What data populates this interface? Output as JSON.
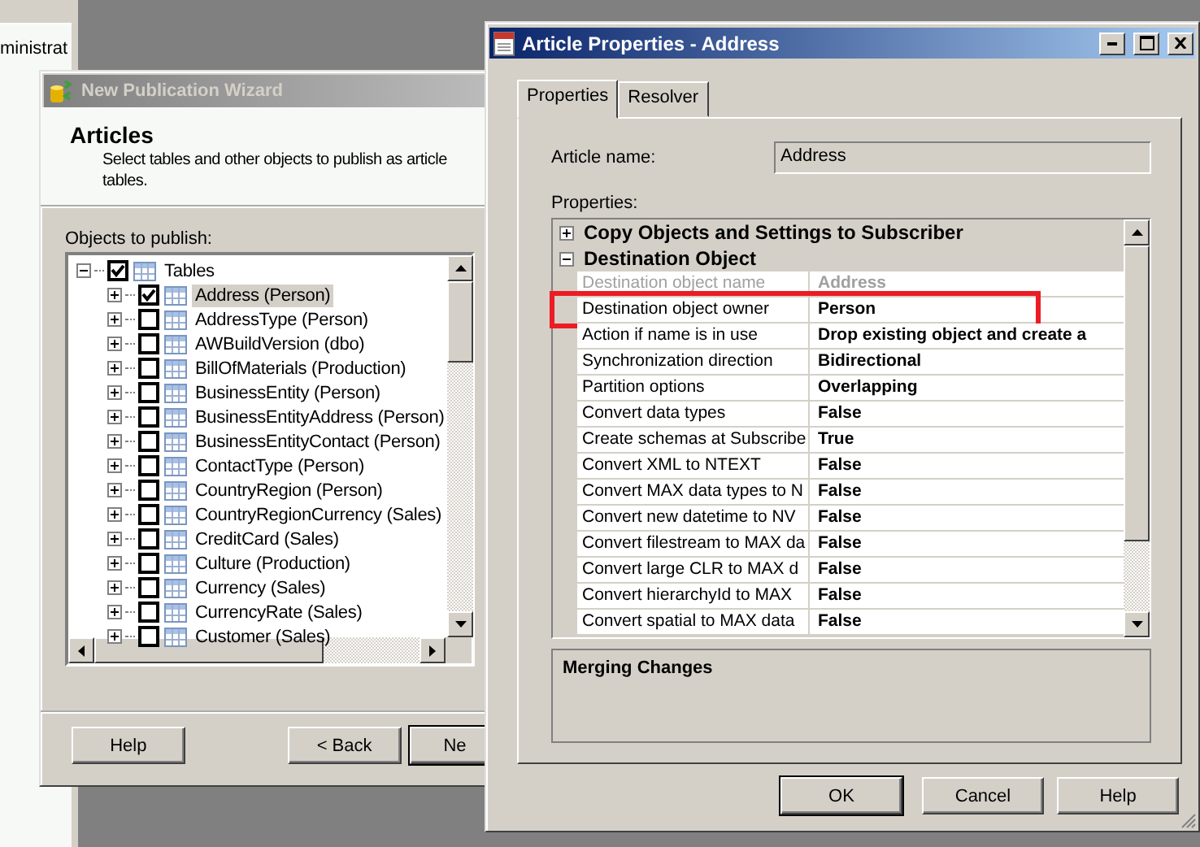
{
  "background_window": {
    "text": "ministrat"
  },
  "wizard": {
    "title": "New Publication Wizard",
    "heading": "Articles",
    "description_lines": [
      "Select tables and other objects to publish as article",
      "tables."
    ],
    "tree_label": "Objects to publish:",
    "tree": [
      {
        "label": "Tables",
        "checked": true,
        "expanded": true,
        "selected": false,
        "children": [
          {
            "label": "Address (Person)",
            "checked": true,
            "expanded": false,
            "selected": true
          },
          {
            "label": "AddressType (Person)",
            "checked": false,
            "expanded": false,
            "selected": false
          },
          {
            "label": "AWBuildVersion (dbo)",
            "checked": false,
            "expanded": false,
            "selected": false
          },
          {
            "label": "BillOfMaterials (Production)",
            "checked": false,
            "expanded": false,
            "selected": false
          },
          {
            "label": "BusinessEntity (Person)",
            "checked": false,
            "expanded": false,
            "selected": false
          },
          {
            "label": "BusinessEntityAddress (Person)",
            "checked": false,
            "expanded": false,
            "selected": false
          },
          {
            "label": "BusinessEntityContact (Person)",
            "checked": false,
            "expanded": false,
            "selected": false
          },
          {
            "label": "ContactType (Person)",
            "checked": false,
            "expanded": false,
            "selected": false
          },
          {
            "label": "CountryRegion (Person)",
            "checked": false,
            "expanded": false,
            "selected": false
          },
          {
            "label": "CountryRegionCurrency (Sales)",
            "checked": false,
            "expanded": false,
            "selected": false
          },
          {
            "label": "CreditCard (Sales)",
            "checked": false,
            "expanded": false,
            "selected": false
          },
          {
            "label": "Culture (Production)",
            "checked": false,
            "expanded": false,
            "selected": false
          },
          {
            "label": "Currency (Sales)",
            "checked": false,
            "expanded": false,
            "selected": false
          },
          {
            "label": "CurrencyRate (Sales)",
            "checked": false,
            "expanded": false,
            "selected": false
          },
          {
            "label": "Customer (Sales)",
            "checked": false,
            "expanded": false,
            "selected": false
          }
        ]
      }
    ],
    "buttons": [
      {
        "label": "Help",
        "default": false
      },
      {
        "label": "< Back",
        "default": false
      },
      {
        "label": "Ne",
        "default": true
      }
    ]
  },
  "properties_window": {
    "title": "Article Properties - Address",
    "tabs": [
      {
        "label": "Properties",
        "selected": true
      },
      {
        "label": "Resolver",
        "selected": false
      }
    ],
    "article_name_label": "Article name:",
    "article_name": "Address",
    "properties_label": "Properties:",
    "categories": [
      {
        "label": "Copy Objects and Settings to Subscriber",
        "expanded": false
      },
      {
        "label": "Destination Object",
        "expanded": true,
        "properties": [
          {
            "name": "Destination object name",
            "value": "Address",
            "disabled": true,
            "highlighted": false
          },
          {
            "name": "Destination object owner",
            "value": "Person",
            "disabled": false,
            "highlighted": true
          },
          {
            "name": "Action if name is in use",
            "value": "Drop existing object and create a",
            "disabled": false,
            "highlighted": false
          },
          {
            "name": "Synchronization direction",
            "value": "Bidirectional",
            "disabled": false,
            "highlighted": false
          },
          {
            "name": "Partition options",
            "value": "Overlapping",
            "disabled": false,
            "highlighted": false
          },
          {
            "name": "Convert data types",
            "value": "False",
            "disabled": false,
            "highlighted": false
          },
          {
            "name": "Create schemas at Subscribe",
            "value": "True",
            "disabled": false,
            "highlighted": false
          },
          {
            "name": "Convert XML to NTEXT",
            "value": "False",
            "disabled": false,
            "highlighted": false
          },
          {
            "name": "Convert MAX data types to N",
            "value": "False",
            "disabled": false,
            "highlighted": false
          },
          {
            "name": "Convert new datetime to NV",
            "value": "False",
            "disabled": false,
            "highlighted": false
          },
          {
            "name": "Convert filestream to MAX da",
            "value": "False",
            "disabled": false,
            "highlighted": false
          },
          {
            "name": "Convert large CLR to MAX d",
            "value": "False",
            "disabled": false,
            "highlighted": false
          },
          {
            "name": "Convert hierarchyId to MAX",
            "value": "False",
            "disabled": false,
            "highlighted": false
          },
          {
            "name": "Convert spatial to MAX data",
            "value": "False",
            "disabled": false,
            "highlighted": false
          }
        ]
      }
    ],
    "description_title": "Merging Changes",
    "buttons": [
      {
        "label": "OK",
        "default": true
      },
      {
        "label": "Cancel",
        "default": false
      },
      {
        "label": "Help",
        "default": false
      }
    ]
  }
}
